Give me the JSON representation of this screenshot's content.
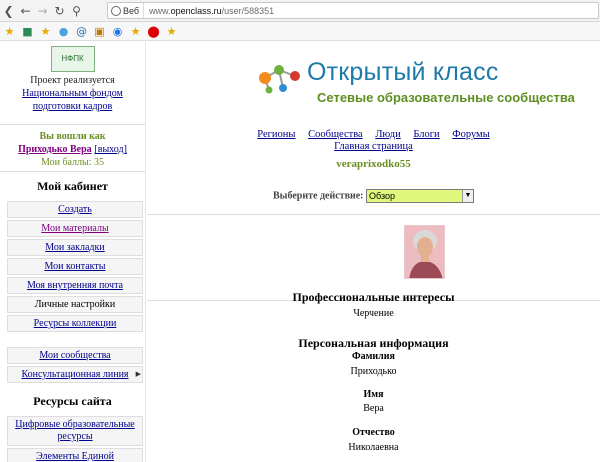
{
  "browser": {
    "web_button": "Веб",
    "url_prefix": "www.",
    "url_domain": "openclass.ru",
    "url_path": "/user/588351"
  },
  "sidebar": {
    "logo_text": "НФПК",
    "project_text": "Проект реализуется",
    "fund_link": "Национальным фондом подготовки кадров",
    "logged_in_as": "Вы вошли как",
    "user_link": "Приходько Вера",
    "logout": "[выход]",
    "points": "Мои баллы: 35",
    "cabinet_heading": "Мой кабинет",
    "cabinet_items": [
      {
        "label": "Создать"
      },
      {
        "label": "Мои материалы"
      },
      {
        "label": "Мои закладки"
      },
      {
        "label": "Мои контакты"
      },
      {
        "label": "Моя внутренняя почта"
      },
      {
        "label": "Личные настройки"
      },
      {
        "label": "Ресурсы коллекции"
      }
    ],
    "community_items": [
      {
        "label": "Мои сообщества"
      },
      {
        "label": "Консультационная линия"
      }
    ],
    "resources_heading": "Ресурсы сайта",
    "resource_items": [
      {
        "label": "Цифровые образовательные ресурсы"
      },
      {
        "label": "Элементы Единой"
      }
    ]
  },
  "brand": {
    "title": "Открытый класс",
    "subtitle": "Сетевые образовательные сообщества"
  },
  "nav": {
    "items": [
      "Регионы",
      "Сообщества",
      "Люди",
      "Блоги",
      "Форумы"
    ],
    "home": "Главная страница"
  },
  "profile": {
    "username": "veraprixodko55",
    "action_label": "Выберите действие:",
    "action_value": "Обзор",
    "interests_title": "Профессиональные интересы",
    "interests_value": "Черчение",
    "personal_title": "Персональная информация",
    "surname_label": "Фамилия",
    "surname_value": "Приходько",
    "name_label": "Имя",
    "name_value": "Вера",
    "patronymic_label": "Отчество",
    "patronymic_value": "Николаевна"
  },
  "colors": {
    "link": "#00008b",
    "visited": "#800080",
    "accent_green": "#6b8e23",
    "brand_blue": "#1e7aa8",
    "select_bg": "#dff77a"
  }
}
